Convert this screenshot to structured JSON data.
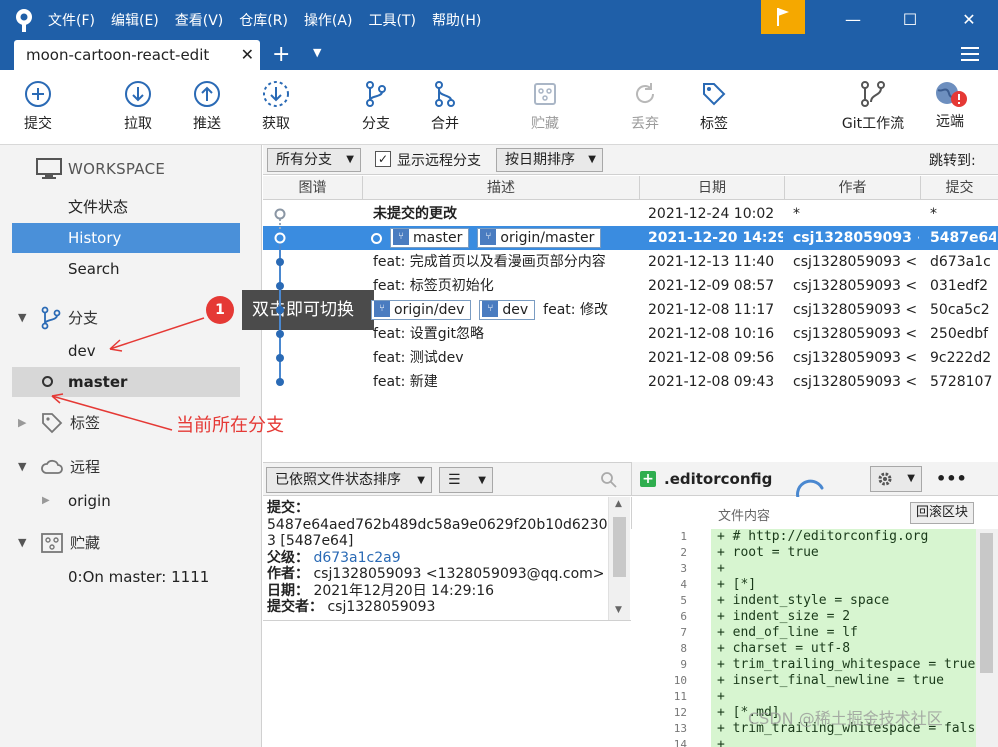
{
  "menu": [
    "文件(F)",
    "编辑(E)",
    "查看(V)",
    "仓库(R)",
    "操作(A)",
    "工具(T)",
    "帮助(H)"
  ],
  "window_controls": {
    "minimize": "—",
    "maximize": "☐",
    "close": "✕"
  },
  "tab": {
    "label": "moon-cartoon-react-edit",
    "close": "✕",
    "plus": "+",
    "dropdown": "▼"
  },
  "toolbar": {
    "commit": "提交",
    "pull": "拉取",
    "push": "推送",
    "fetch": "获取",
    "branch": "分支",
    "merge": "合并",
    "stash": "贮藏",
    "discard": "丢弃",
    "tag": "标签",
    "gitflow": "Git工作流",
    "remote": "远端"
  },
  "sidebar": {
    "workspace": "WORKSPACE",
    "file_status": "文件状态",
    "history": "History",
    "search": "Search",
    "branches": "分支",
    "branch_dev": "dev",
    "branch_master": "master",
    "tags": "标签",
    "remotes": "远程",
    "remote_origin": "origin",
    "stashes": "贮藏",
    "stash_item": "0:On master: 1111"
  },
  "annotation": {
    "badge": "1",
    "tooltip": "双击即可切换",
    "current_branch_note": "当前所在分支"
  },
  "filter": {
    "all_branches": "所有分支",
    "show_remote": "显示远程分支",
    "show_remote_checked": true,
    "sort_by_date": "按日期排序",
    "jump_to": "跳转到:"
  },
  "columns": {
    "graph": "图谱",
    "desc": "描述",
    "date": "日期",
    "author": "作者",
    "commit": "提交"
  },
  "commits": [
    {
      "desc": "未提交的更改",
      "date": "2021-12-24 10:02",
      "author": "*",
      "hash": "*",
      "bold": true
    },
    {
      "tags": [
        "master",
        "origin/master"
      ],
      "desc": "",
      "date": "2021-12-20 14:29",
      "author": "csj1328059093 <",
      "hash": "5487e64",
      "selected": true
    },
    {
      "desc": "feat: 完成首页以及看漫画页部分内容",
      "date": "2021-12-13 11:40",
      "author": "csj1328059093 <",
      "hash": "d673a1c"
    },
    {
      "desc": "feat: 标签页初始化",
      "date": "2021-12-09 08:57",
      "author": "csj1328059093 <",
      "hash": "031edf2"
    },
    {
      "tags": [
        "origin/dev",
        "dev"
      ],
      "desc": "feat: 修改",
      "date": "2021-12-08 11:17",
      "author": "csj1328059093 <",
      "hash": "50ca5c2"
    },
    {
      "desc": "feat: 设置git忽略",
      "date": "2021-12-08 10:16",
      "author": "csj1328059093 <",
      "hash": "250edbf"
    },
    {
      "desc": "feat: 测试dev",
      "date": "2021-12-08 09:56",
      "author": "csj1328059093 <",
      "hash": "9c222d2"
    },
    {
      "desc": "feat: 新建",
      "date": "2021-12-08 09:43",
      "author": "csj1328059093 <",
      "hash": "5728107"
    }
  ],
  "lower": {
    "sort_label": "已依照文件状态排序",
    "list_icon": "☰",
    "commit_label": "提交：",
    "commit_hash": "5487e64aed762b489dc58a9e0629f20b10d6230",
    "commit_hash_tail": "3 [5487e64]",
    "parent_label": "父级：",
    "parent": "d673a1c2a9",
    "author_label": "作者：",
    "author": "csj1328059093 <1328059093@qq.com>",
    "date_label": "日期：",
    "date": "2021年12月20日 14:29:16",
    "committer_label": "提交者：",
    "committer": "csj1328059093"
  },
  "diff": {
    "file": ".editorconfig",
    "more": "•••",
    "content_label": "文件内容",
    "revert_hunk": "回滚区块",
    "lines": [
      {
        "n": "1",
        "t": "+ # http://editorconfig.org"
      },
      {
        "n": "2",
        "t": "+ root = true"
      },
      {
        "n": "3",
        "t": "+"
      },
      {
        "n": "4",
        "t": "+ [*]"
      },
      {
        "n": "5",
        "t": "+ indent_style = space"
      },
      {
        "n": "6",
        "t": "+ indent_size = 2"
      },
      {
        "n": "7",
        "t": "+ end_of_line = lf"
      },
      {
        "n": "8",
        "t": "+ charset = utf-8"
      },
      {
        "n": "9",
        "t": "+ trim_trailing_whitespace = true"
      },
      {
        "n": "10",
        "t": "+ insert_final_newline = true"
      },
      {
        "n": "11",
        "t": "+"
      },
      {
        "n": "12",
        "t": "+ [*.md]"
      },
      {
        "n": "13",
        "t": "+ trim_trailing_whitespace = false"
      },
      {
        "n": "14",
        "t": "+"
      }
    ]
  },
  "watermark": "CSDN @稀土掘金技术社区"
}
